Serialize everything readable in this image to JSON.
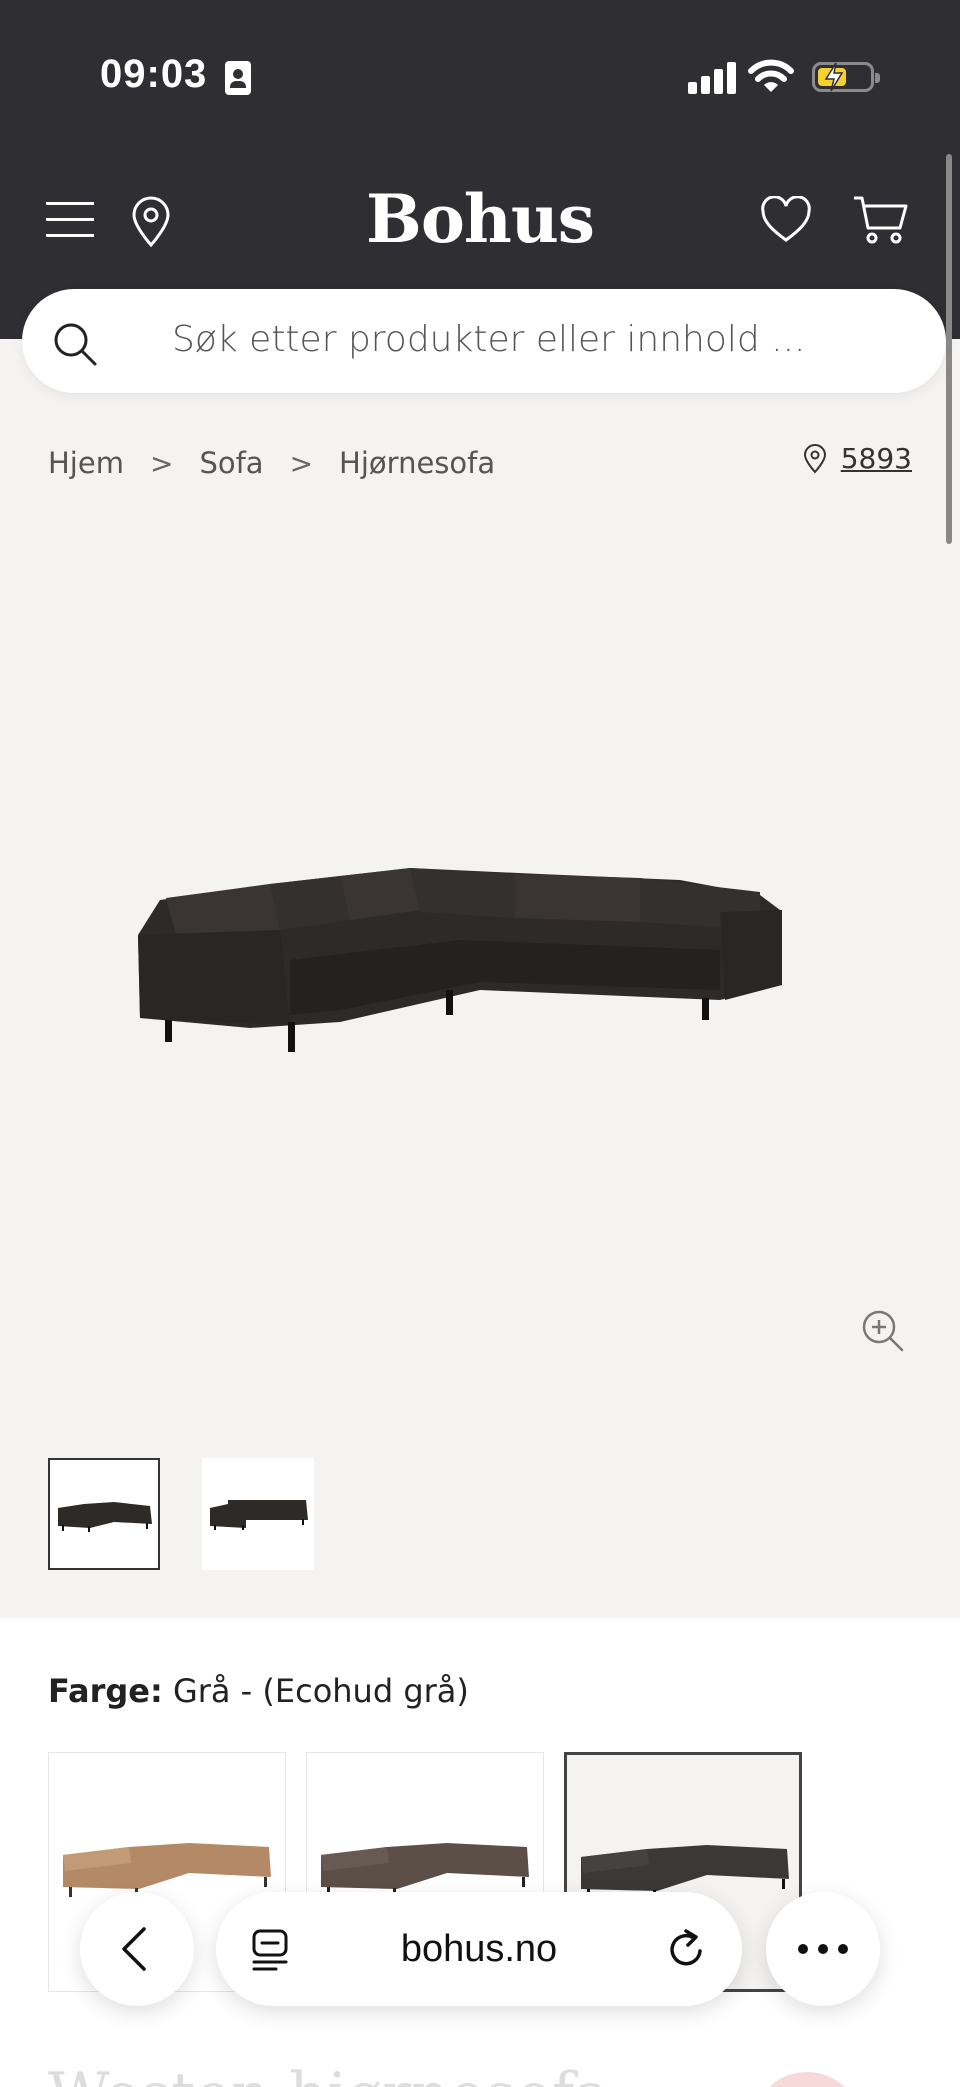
{
  "status_bar": {
    "time": "09:03"
  },
  "header": {
    "logo": "Bohus",
    "menu_icon": "hamburger-menu-icon",
    "location_icon": "map-pin-icon",
    "wishlist_icon": "heart-icon",
    "cart_icon": "cart-icon"
  },
  "search": {
    "placeholder": "Søk etter produkter eller innhold ..."
  },
  "breadcrumb": {
    "items": [
      "Hjem",
      "Sofa",
      "Hjørnesofa"
    ],
    "separator": ">"
  },
  "store": {
    "number": "5893"
  },
  "product": {
    "image_alt": "corner-sofa-image",
    "thumbnails": [
      {
        "name": "thumbnail-1",
        "selected": true
      },
      {
        "name": "thumbnail-2",
        "selected": false
      }
    ]
  },
  "color_picker": {
    "label": "Farge:",
    "value": "Grå - (Ecohud grå)",
    "swatches": [
      {
        "name": "swatch-cognac",
        "color": "#b48a66",
        "selected": false
      },
      {
        "name": "swatch-brown",
        "color": "#5b4f48",
        "selected": false
      },
      {
        "name": "swatch-grey",
        "color": "#3b3836",
        "selected": true
      }
    ]
  },
  "product_title_partial": "Weston hjørnesofa",
  "browser": {
    "url": "bohus.no"
  },
  "colors": {
    "header_bg": "#2f2e33",
    "page_bg": "#f4f3f2",
    "sofa": "#2e2a27"
  }
}
